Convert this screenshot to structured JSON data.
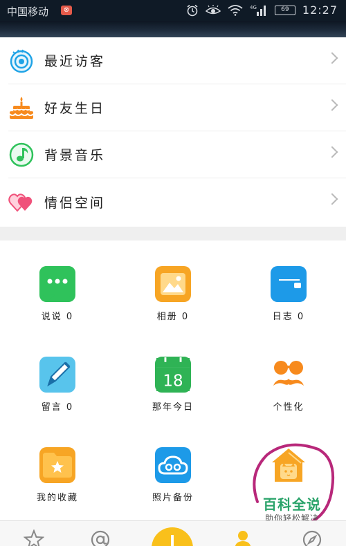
{
  "status_bar": {
    "carrier": "中国移动",
    "network": "4G",
    "battery": "69",
    "time": "12:27"
  },
  "menu": {
    "items": [
      {
        "label": "最近访客",
        "icon": "eye-icon"
      },
      {
        "label": "好友生日",
        "icon": "cake-icon"
      },
      {
        "label": "背景音乐",
        "icon": "music-note-icon"
      },
      {
        "label": "情侣空间",
        "icon": "hearts-icon"
      }
    ]
  },
  "grid": {
    "items": [
      {
        "label": "说说 0",
        "icon": "chat-bubble-icon",
        "color": "#2fc25b"
      },
      {
        "label": "相册 0",
        "icon": "photo-album-icon",
        "color": "#f7a524"
      },
      {
        "label": "日志 0",
        "icon": "diary-icon",
        "color": "#1d9ae8"
      },
      {
        "label": "留言 0",
        "icon": "pen-icon",
        "color": "#58c4ec"
      },
      {
        "label": "那年今日",
        "icon": "calendar-icon",
        "color": "#2fb355"
      },
      {
        "label": "个性化",
        "icon": "mustache-glasses-icon",
        "color": "#f78a1d"
      },
      {
        "label": "我的收藏",
        "icon": "favorites-folder-icon",
        "color": "#f7a524"
      },
      {
        "label": "照片备份",
        "icon": "cloud-backup-icon",
        "color": "#1d9ae8"
      },
      {
        "label": "",
        "icon": "cat-house-icon",
        "color": "#f7a524"
      }
    ]
  },
  "calendar_day": "18",
  "watermark": {
    "title": "百科全说",
    "subtitle": "助你轻松解决"
  },
  "bottom_nav": {
    "items": [
      "star-tab-icon",
      "at-tab-icon",
      "add-tab-icon",
      "person-tab-icon",
      "compass-tab-icon"
    ]
  },
  "colors": {
    "accent_yellow": "#f9c01b",
    "annotation_circle": "#b8287a",
    "watermark_green": "#2aa36a"
  }
}
